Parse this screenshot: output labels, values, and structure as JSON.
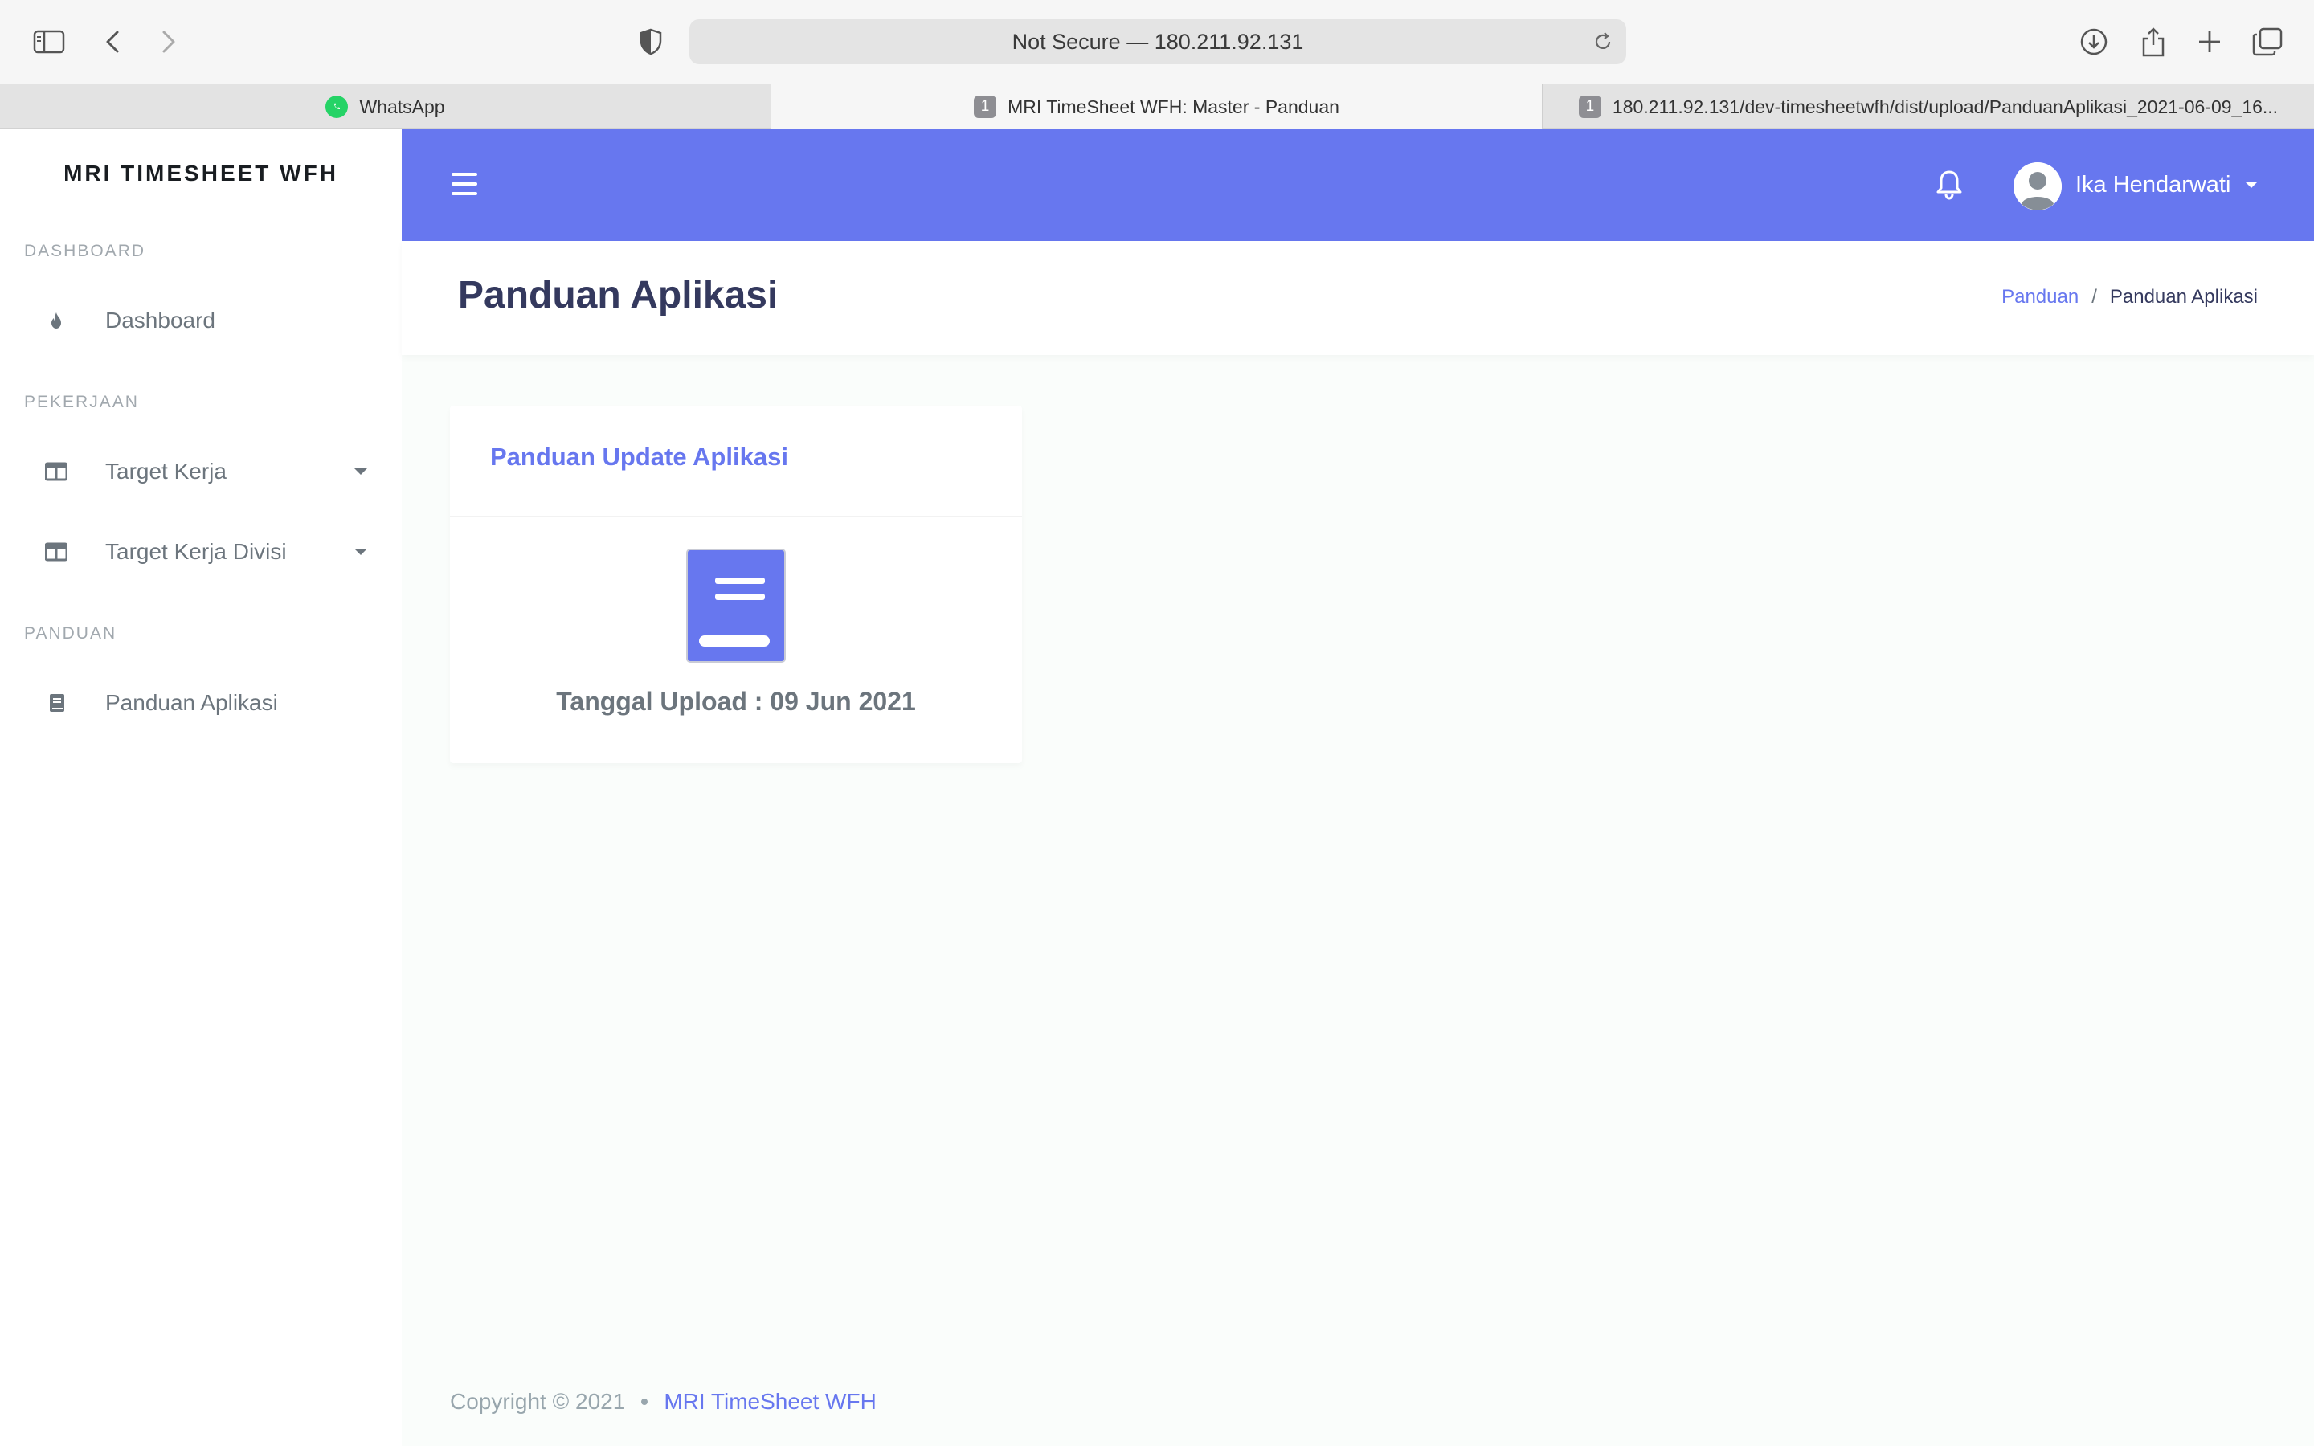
{
  "browser": {
    "url": "Not Secure — 180.211.92.131",
    "tabs": [
      {
        "label": "WhatsApp",
        "favicon": "whatsapp-icon",
        "active": false
      },
      {
        "label": "MRI TimeSheet WFH: Master - Panduan",
        "favicon_text": "1",
        "active": true
      },
      {
        "label": "180.211.92.131/dev-timesheetwfh/dist/upload/PanduanAplikasi_2021-06-09_16...",
        "favicon_text": "1",
        "active": false
      }
    ]
  },
  "sidebar": {
    "brand": "MRI TIMESHEET WFH",
    "sections": [
      {
        "header": "DASHBOARD",
        "items": [
          {
            "label": "Dashboard",
            "icon": "fire-icon"
          }
        ]
      },
      {
        "header": "PEKERJAAN",
        "items": [
          {
            "label": "Target Kerja",
            "icon": "columns-icon",
            "dropdown": true
          },
          {
            "label": "Target Kerja Divisi",
            "icon": "columns-icon",
            "dropdown": true
          }
        ]
      },
      {
        "header": "PANDUAN",
        "items": [
          {
            "label": "Panduan Aplikasi",
            "icon": "book-icon"
          }
        ]
      }
    ]
  },
  "navbar": {
    "user_name": "Ika Hendarwati"
  },
  "page": {
    "title": "Panduan Aplikasi",
    "breadcrumb": {
      "link": "Panduan",
      "separator": "/",
      "current": "Panduan Aplikasi"
    }
  },
  "card": {
    "title": "Panduan Update Aplikasi",
    "upload_label": "Tanggal Upload : 09 Jun 2021"
  },
  "footer": {
    "copyright": "Copyright © 2021",
    "link": "MRI TimeSheet WFH"
  },
  "colors": {
    "primary": "#6777ef",
    "sidebar_bg": "#ffffff",
    "body_bg": "#fafdfb"
  }
}
